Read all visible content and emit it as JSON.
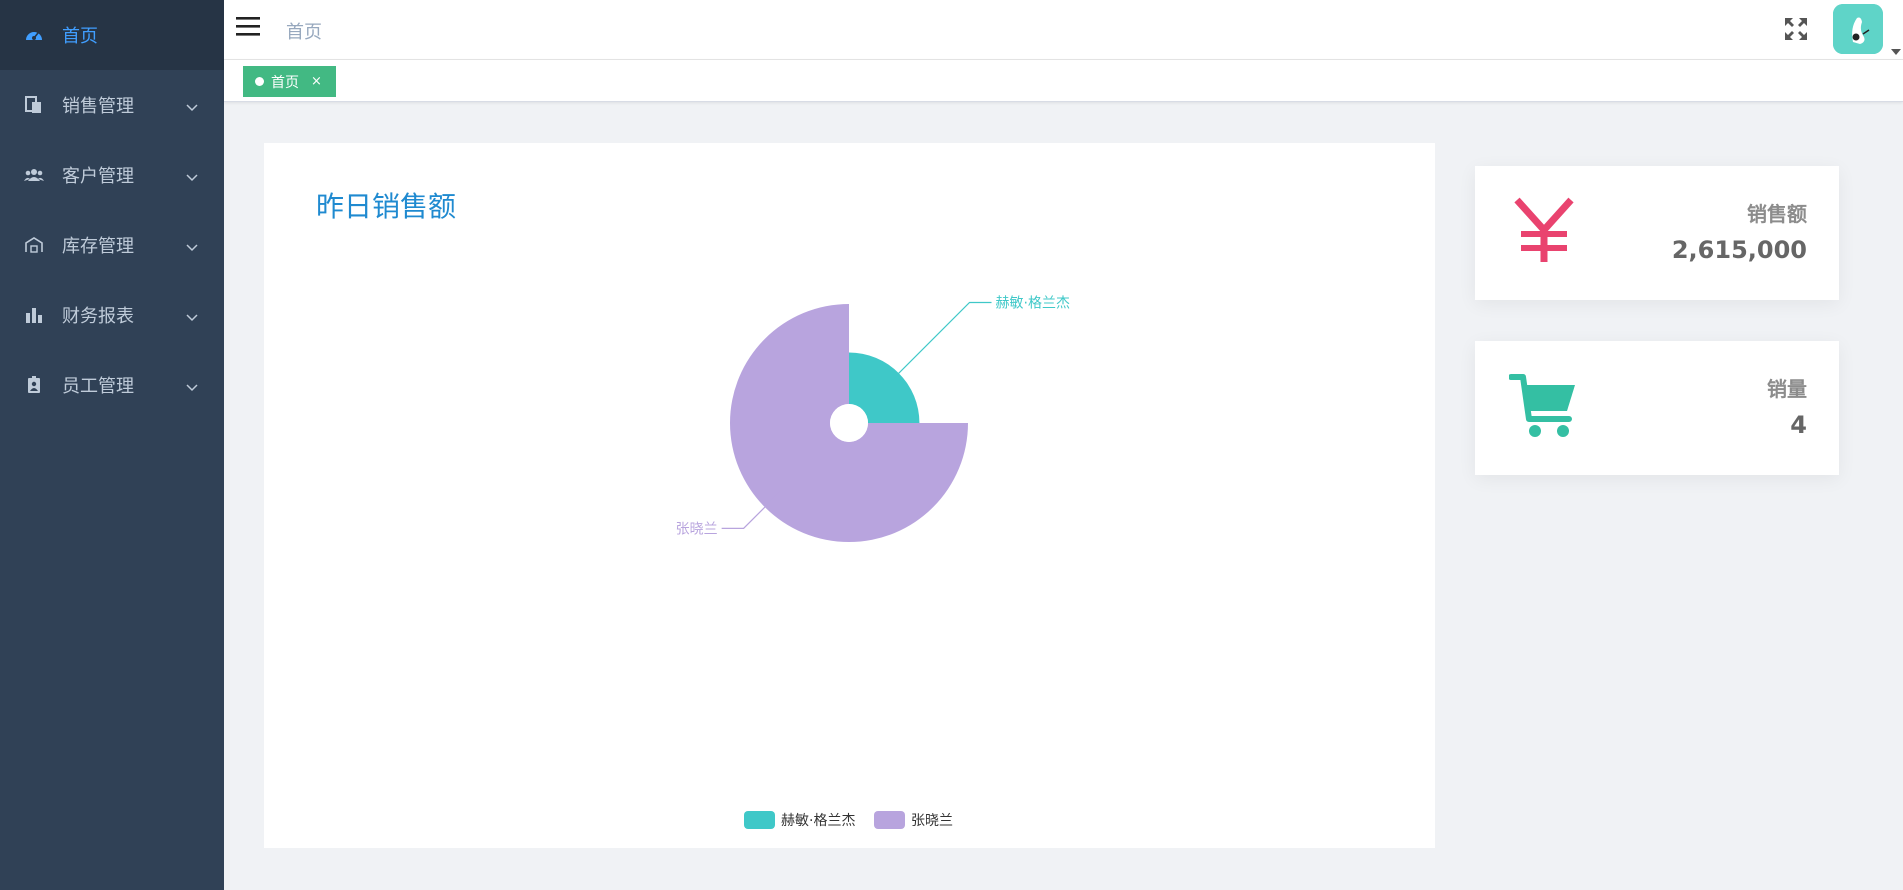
{
  "sidebar": {
    "items": [
      {
        "label": "首页",
        "icon": "dashboard-icon",
        "active": true
      },
      {
        "label": "销售管理",
        "icon": "sales-icon"
      },
      {
        "label": "客户管理",
        "icon": "customers-icon"
      },
      {
        "label": "库存管理",
        "icon": "warehouse-icon"
      },
      {
        "label": "财务报表",
        "icon": "bar-chart-icon"
      },
      {
        "label": "员工管理",
        "icon": "employee-badge-icon"
      }
    ]
  },
  "header": {
    "breadcrumb": "首页"
  },
  "tags": [
    {
      "label": "首页",
      "close": "×"
    }
  ],
  "chart_card": {
    "title": "昨日销售额"
  },
  "stats": [
    {
      "label": "销售额",
      "value": "2,615,000",
      "icon": "yen-icon",
      "color": "#e9436f"
    },
    {
      "label": "销量",
      "value": "4",
      "icon": "shopping-cart-icon",
      "color": "#34bfa3"
    }
  ],
  "chart_data": {
    "type": "pie",
    "rose": true,
    "series": [
      {
        "name": "赫敏·格兰杰",
        "value": 1,
        "color": "#3fc8c8"
      },
      {
        "name": "张晓兰",
        "value": 3,
        "color": "#b8a4de"
      }
    ],
    "legend": [
      "赫敏·格兰杰",
      "张晓兰"
    ],
    "legend_position": "bottom-center"
  },
  "colors": {
    "sidebar_bg": "#304156",
    "sidebar_active_text": "#409eff",
    "tag_active": "#42b983",
    "title_blue": "#1f8ad0"
  }
}
